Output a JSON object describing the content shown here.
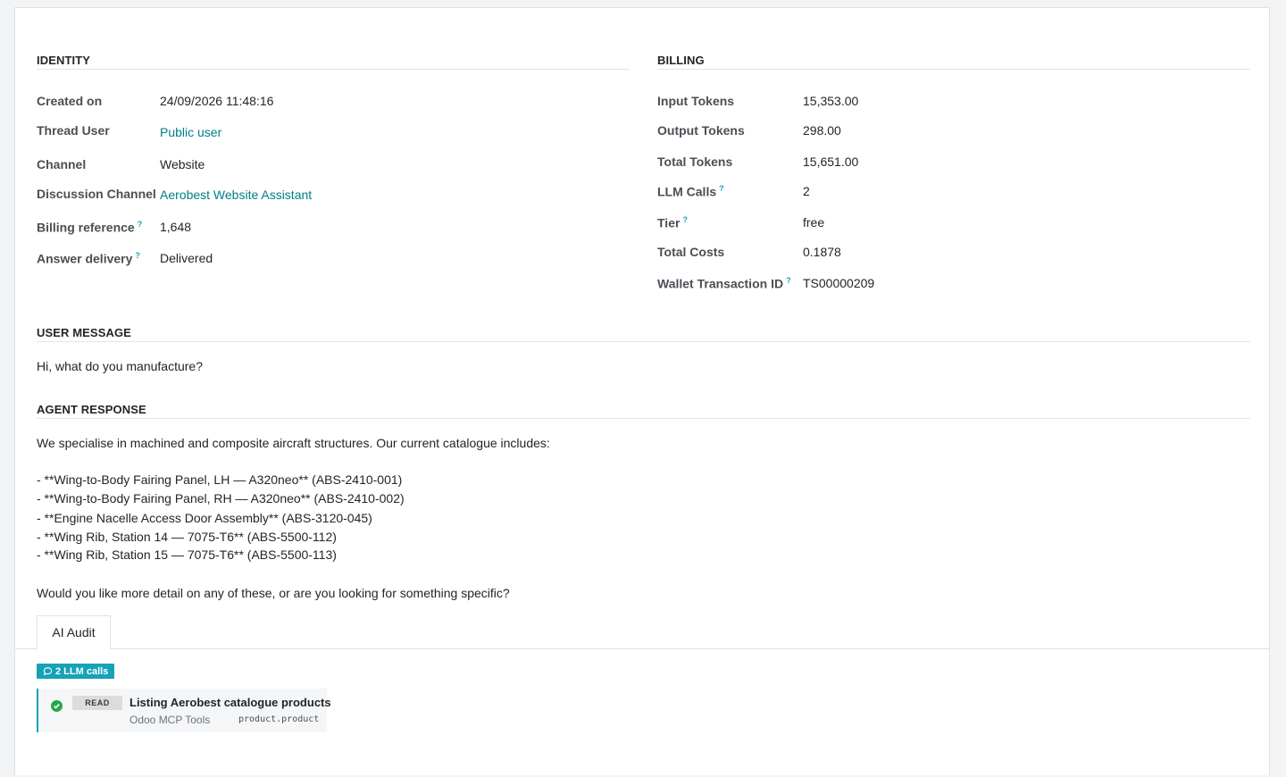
{
  "identity": {
    "title": "IDENTITY",
    "fields": [
      {
        "label": "Created on",
        "value": "24/09/2026 11:48:16",
        "help": false,
        "link": false
      },
      {
        "label": "Thread User",
        "value": "Public user",
        "help": false,
        "link": true
      },
      {
        "label": "Channel",
        "value": "Website",
        "help": false,
        "link": false
      },
      {
        "label": "Discussion Channel",
        "value": "Aerobest Website Assistant",
        "help": false,
        "link": true
      },
      {
        "label": "Billing reference",
        "value": "1,648",
        "help": true,
        "link": false
      },
      {
        "label": "Answer delivery",
        "value": "Delivered",
        "help": true,
        "link": false
      }
    ]
  },
  "billing": {
    "title": "BILLING",
    "fields": [
      {
        "label": "Input Tokens",
        "value": "15,353.00",
        "help": false
      },
      {
        "label": "Output Tokens",
        "value": "298.00",
        "help": false
      },
      {
        "label": "Total Tokens",
        "value": "15,651.00",
        "help": false
      },
      {
        "label": "LLM Calls",
        "value": "2",
        "help": true
      },
      {
        "label": "Tier",
        "value": "free",
        "help": true
      },
      {
        "label": "Total Costs",
        "value": "0.1878",
        "help": false
      },
      {
        "label": "Wallet Transaction ID",
        "value": "TS00000209",
        "help": true
      }
    ]
  },
  "help_marker": "?",
  "user_message": {
    "title": "USER MESSAGE",
    "text": "Hi, what do you manufacture?"
  },
  "agent_response": {
    "title": "AGENT RESPONSE",
    "intro": "We specialise in machined and composite aircraft structures. Our current catalogue includes:",
    "items": [
      "- **Wing-to-Body Fairing Panel, LH — A320neo** (ABS-2410-001)",
      "- **Wing-to-Body Fairing Panel, RH — A320neo** (ABS-2410-002)",
      "- **Engine Nacelle Access Door Assembly** (ABS-3120-045)",
      "- **Wing Rib, Station 14 — 7075-T6** (ABS-5500-112)",
      "- **Wing Rib, Station 15 — 7075-T6** (ABS-5500-113)"
    ],
    "outro": "Would you like more detail on any of these, or are you looking for something specific?"
  },
  "tabs": [
    {
      "label": "AI Audit"
    }
  ],
  "audit": {
    "badge_label": "2 LLM calls",
    "badge_icon": "chat-bubble-icon",
    "calls": [
      {
        "status_icon": "check-circle-icon",
        "operation": "READ",
        "title": "Listing Aerobest catalogue products",
        "source": "Odoo MCP Tools",
        "model": "product.product"
      }
    ]
  },
  "colors": {
    "link": "#017e84",
    "badge": "#17a2b8",
    "success": "#28a745",
    "help": "#1aa3b5"
  }
}
